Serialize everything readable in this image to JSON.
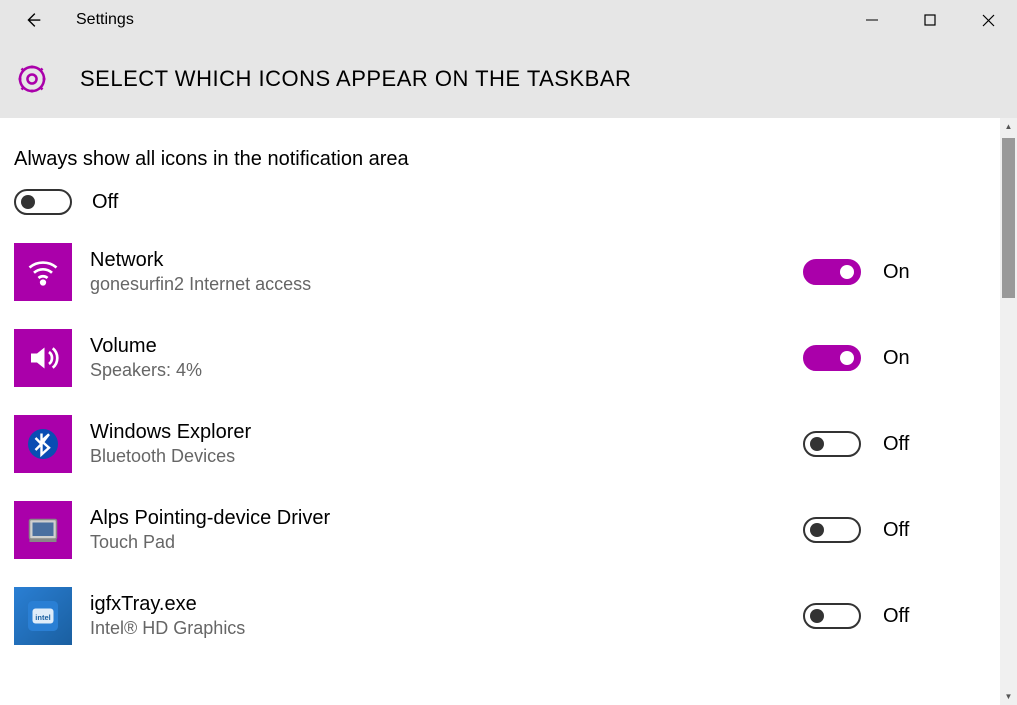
{
  "window": {
    "title": "Settings"
  },
  "page": {
    "heading": "SELECT WHICH ICONS APPEAR ON THE TASKBAR",
    "master_label": "Always show all icons in the notification area",
    "master_state": "Off",
    "on_text": "On",
    "off_text": "Off"
  },
  "items": [
    {
      "title": "Network",
      "subtitle": "gonesurfin2 Internet access",
      "state": "On",
      "icon": "wifi"
    },
    {
      "title": "Volume",
      "subtitle": "Speakers: 4%",
      "state": "On",
      "icon": "volume"
    },
    {
      "title": "Windows Explorer",
      "subtitle": "Bluetooth Devices",
      "state": "Off",
      "icon": "bluetooth"
    },
    {
      "title": "Alps Pointing-device Driver",
      "subtitle": "Touch Pad",
      "state": "Off",
      "icon": "touchpad"
    },
    {
      "title": "igfxTray.exe",
      "subtitle": "Intel® HD Graphics",
      "state": "Off",
      "icon": "intel"
    }
  ],
  "colors": {
    "accent": "#aa00aa"
  }
}
